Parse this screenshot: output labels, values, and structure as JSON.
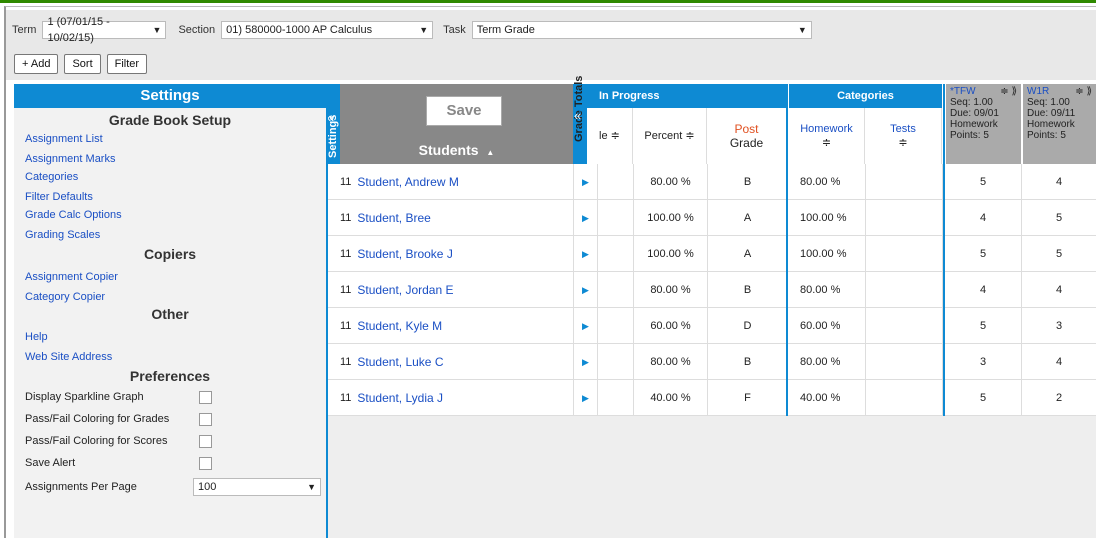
{
  "toolbar": {
    "term_label": "Term",
    "term_value": "1 (07/01/15 - 10/02/15)",
    "section_label": "Section",
    "section_value": "01) 580000-1000 AP Calculus",
    "task_label": "Task",
    "task_value": "Term Grade",
    "add_label": "+ Add",
    "sort_label": "Sort",
    "filter_label": "Filter"
  },
  "settings": {
    "title": "Settings",
    "collapse_label": "Settings",
    "setup_title": "Grade Book Setup",
    "setup_links": [
      "Assignment List",
      "Assignment Marks",
      "Categories",
      "Filter Defaults",
      "Grade Calc Options",
      "Grading Scales"
    ],
    "copiers_title": "Copiers",
    "copiers_links": [
      "Assignment Copier",
      "Category Copier"
    ],
    "other_title": "Other",
    "other_links": [
      "Help",
      "Web Site Address"
    ],
    "prefs_title": "Preferences",
    "prefs": [
      "Display Sparkline Graph",
      "Pass/Fail Coloring for Grades",
      "Pass/Fail Coloring for Scores",
      "Save Alert"
    ],
    "per_page_label": "Assignments Per Page",
    "per_page_value": "100"
  },
  "students_header": {
    "save_label": "Save",
    "title": "Students",
    "sort_icon": "▲"
  },
  "grade_totals_label": "Grade Totals",
  "grid": {
    "in_progress_label": "In Progress",
    "categories_label": "Categories",
    "col_partial": "le ≑",
    "col_percent": "Percent ≑",
    "col_post": "Post",
    "col_grade": "Grade",
    "col_homework": "Homework",
    "col_tests": "Tests",
    "sort_glyph": "≑",
    "asg1": {
      "name": "*TFW",
      "seq": "Seq: 1.00",
      "due": "Due: 09/01",
      "cat": "Homework",
      "points": "Points: 5"
    },
    "asg2": {
      "name": "W1R",
      "seq": "Seq: 1.00",
      "due": "Due: 09/11",
      "cat": "Homework",
      "points": "Points: 5"
    }
  },
  "students": [
    {
      "num": "11",
      "name": "Student, Andrew M",
      "percent": "80.00 %",
      "grade": "B",
      "homework": "80.00 %",
      "s1": "5",
      "s2": "4"
    },
    {
      "num": "11",
      "name": "Student, Bree",
      "percent": "100.00 %",
      "grade": "A",
      "homework": "100.00 %",
      "s1": "4",
      "s2": "5"
    },
    {
      "num": "11",
      "name": "Student, Brooke J",
      "percent": "100.00 %",
      "grade": "A",
      "homework": "100.00 %",
      "s1": "5",
      "s2": "5"
    },
    {
      "num": "11",
      "name": "Student, Jordan E",
      "percent": "80.00 %",
      "grade": "B",
      "homework": "80.00 %",
      "s1": "4",
      "s2": "4"
    },
    {
      "num": "11",
      "name": "Student, Kyle M",
      "percent": "60.00 %",
      "grade": "D",
      "homework": "60.00 %",
      "s1": "5",
      "s2": "3"
    },
    {
      "num": "11",
      "name": "Student, Luke C",
      "percent": "80.00 %",
      "grade": "B",
      "homework": "80.00 %",
      "s1": "3",
      "s2": "4"
    },
    {
      "num": "11",
      "name": "Student, Lydia J",
      "percent": "40.00 %",
      "grade": "F",
      "homework": "40.00 %",
      "s1": "5",
      "s2": "2"
    }
  ]
}
